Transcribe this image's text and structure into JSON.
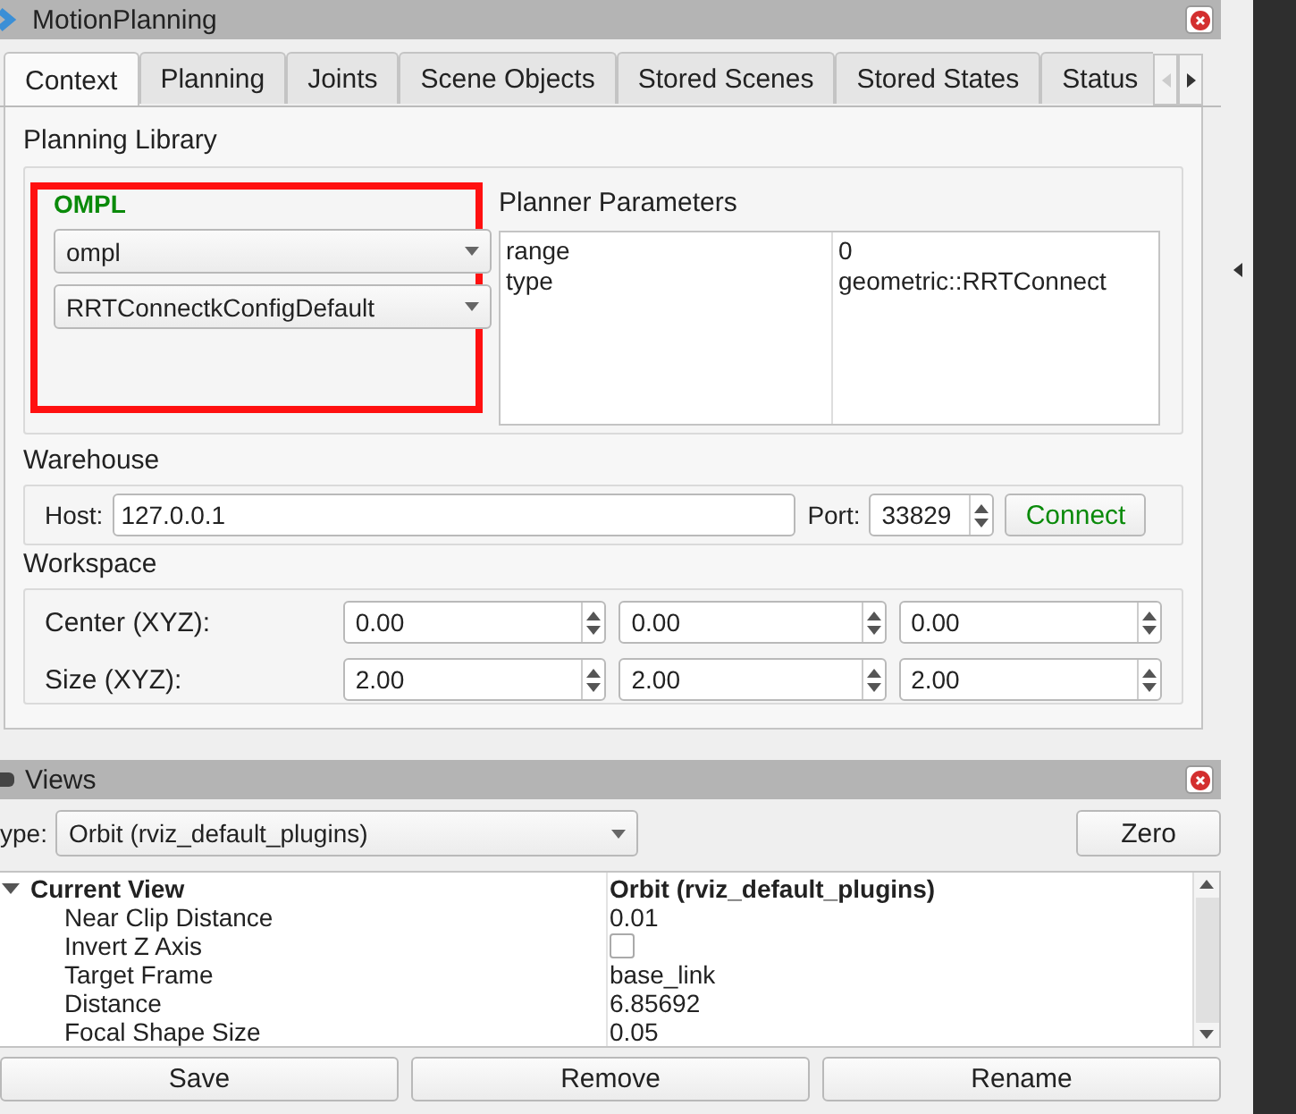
{
  "window": {
    "title": "MotionPlanning"
  },
  "tabs": [
    {
      "label": "Context",
      "selected": true
    },
    {
      "label": "Planning",
      "selected": false
    },
    {
      "label": "Joints",
      "selected": false
    },
    {
      "label": "Scene Objects",
      "selected": false
    },
    {
      "label": "Stored Scenes",
      "selected": false
    },
    {
      "label": "Stored States",
      "selected": false
    },
    {
      "label": "Status",
      "selected": false
    }
  ],
  "planning_library": {
    "title": "Planning Library",
    "group_label": "OMPL",
    "highlighted": true,
    "library": "ompl",
    "planner": "RRTConnectkConfigDefault"
  },
  "planner_parameters": {
    "title": "Planner Parameters",
    "rows": [
      {
        "name": "range",
        "value": "0"
      },
      {
        "name": "type",
        "value": "geometric::RRTConnect"
      }
    ]
  },
  "warehouse": {
    "title": "Warehouse",
    "host_label": "Host:",
    "host": "127.0.0.1",
    "port_label": "Port:",
    "port": "33829",
    "connect": "Connect"
  },
  "workspace": {
    "title": "Workspace",
    "rows": [
      {
        "label": "Center (XYZ):",
        "values": [
          "0.00",
          "0.00",
          "0.00"
        ]
      },
      {
        "label": "Size (XYZ):",
        "values": [
          "2.00",
          "2.00",
          "2.00"
        ]
      }
    ]
  },
  "views": {
    "title": "Views",
    "type_label": "ype:",
    "type": "Orbit (rviz_default_plugins)",
    "zero": "Zero",
    "tree": {
      "name": "Current View",
      "value": "Orbit (rviz_default_plugins)",
      "expanded": true,
      "children": [
        {
          "kind": "value",
          "name": "Near Clip Distance",
          "value": "0.01"
        },
        {
          "kind": "checkbox",
          "name": "Invert Z Axis",
          "checked": false
        },
        {
          "kind": "value",
          "name": "Target Frame",
          "value": "base_link"
        },
        {
          "kind": "value",
          "name": "Distance",
          "value": "6.85692"
        },
        {
          "kind": "value",
          "name": "Focal Shape Size",
          "value": "0.05"
        }
      ]
    },
    "buttons": [
      "Save",
      "Remove",
      "Rename"
    ]
  }
}
